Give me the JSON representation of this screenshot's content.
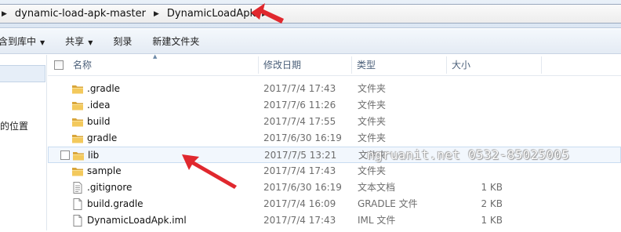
{
  "breadcrumb": {
    "items": [
      "dynamic-load-apk-master",
      "DynamicLoadApk"
    ]
  },
  "toolbar": {
    "include_in_library": "含到库中",
    "share": "共享",
    "burn": "刻录",
    "new_folder": "新建文件夹"
  },
  "nav": {
    "partial_label": "的位置"
  },
  "columns": {
    "name": "名称",
    "date": "修改日期",
    "type": "类型",
    "size": "大小"
  },
  "files": [
    {
      "name": ".gradle",
      "date": "2017/7/4 17:43",
      "type": "文件夹",
      "size": "",
      "icon": "folder-icon"
    },
    {
      "name": ".idea",
      "date": "2017/7/6 11:26",
      "type": "文件夹",
      "size": "",
      "icon": "folder-icon"
    },
    {
      "name": "build",
      "date": "2017/7/4 17:55",
      "type": "文件夹",
      "size": "",
      "icon": "folder-icon"
    },
    {
      "name": "gradle",
      "date": "2017/6/30 16:19",
      "type": "文件夹",
      "size": "",
      "icon": "folder-icon"
    },
    {
      "name": "lib",
      "date": "2017/7/5 13:21",
      "type": "文件夹",
      "size": "",
      "icon": "folder-icon"
    },
    {
      "name": "sample",
      "date": "2017/7/4 17:43",
      "type": "文件夹",
      "size": "",
      "icon": "folder-icon"
    },
    {
      "name": ".gitignore",
      "date": "2017/6/30 16:19",
      "type": "文本文档",
      "size": "1 KB",
      "icon": "text-file-icon"
    },
    {
      "name": "build.gradle",
      "date": "2017/7/4 16:09",
      "type": "GRADLE 文件",
      "size": "2 KB",
      "icon": "file-icon"
    },
    {
      "name": "DynamicLoadApk.iml",
      "date": "2017/7/4 17:43",
      "type": "IML 文件",
      "size": "1 KB",
      "icon": "file-icon"
    }
  ],
  "watermark": "ngruanit.net 0532-85025005",
  "colors": {
    "folder": "#e8b84a",
    "annotation_arrow": "#e0282e",
    "hover_bg": "#f2f7fd"
  }
}
